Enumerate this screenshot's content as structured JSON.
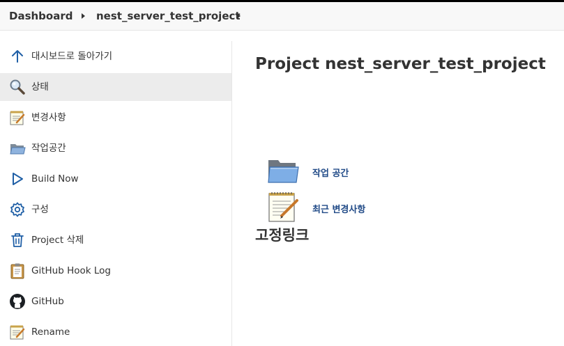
{
  "breadcrumb": {
    "items": [
      {
        "label": "Dashboard"
      },
      {
        "label": "nest_server_test_project"
      }
    ]
  },
  "sidebar": {
    "items": [
      {
        "label": "대시보드로 돌아가기",
        "icon": "arrow-up-icon"
      },
      {
        "label": "상태",
        "icon": "search-icon",
        "active": true
      },
      {
        "label": "변경사항",
        "icon": "notepad-icon"
      },
      {
        "label": "작업공간",
        "icon": "folder-icon"
      },
      {
        "label": "Build Now",
        "icon": "play-icon"
      },
      {
        "label": "구성",
        "icon": "gear-icon"
      },
      {
        "label": "Project 삭제",
        "icon": "trash-icon"
      },
      {
        "label": "GitHub Hook Log",
        "icon": "clipboard-icon"
      },
      {
        "label": "GitHub",
        "icon": "github-icon"
      },
      {
        "label": "Rename",
        "icon": "notepad-icon"
      }
    ]
  },
  "main": {
    "title": "Project nest_server_test_project",
    "links": [
      {
        "label": "작업 공간",
        "icon": "folder-icon"
      },
      {
        "label": "최근 변경사항",
        "icon": "notepad-icon"
      }
    ],
    "permalinks_title": "고정링크"
  },
  "colors": {
    "link": "#204a87",
    "active_bg": "#ececec",
    "breadcrumb_bg": "#f8f8f8",
    "icon_blue": "#1f5fa6"
  }
}
